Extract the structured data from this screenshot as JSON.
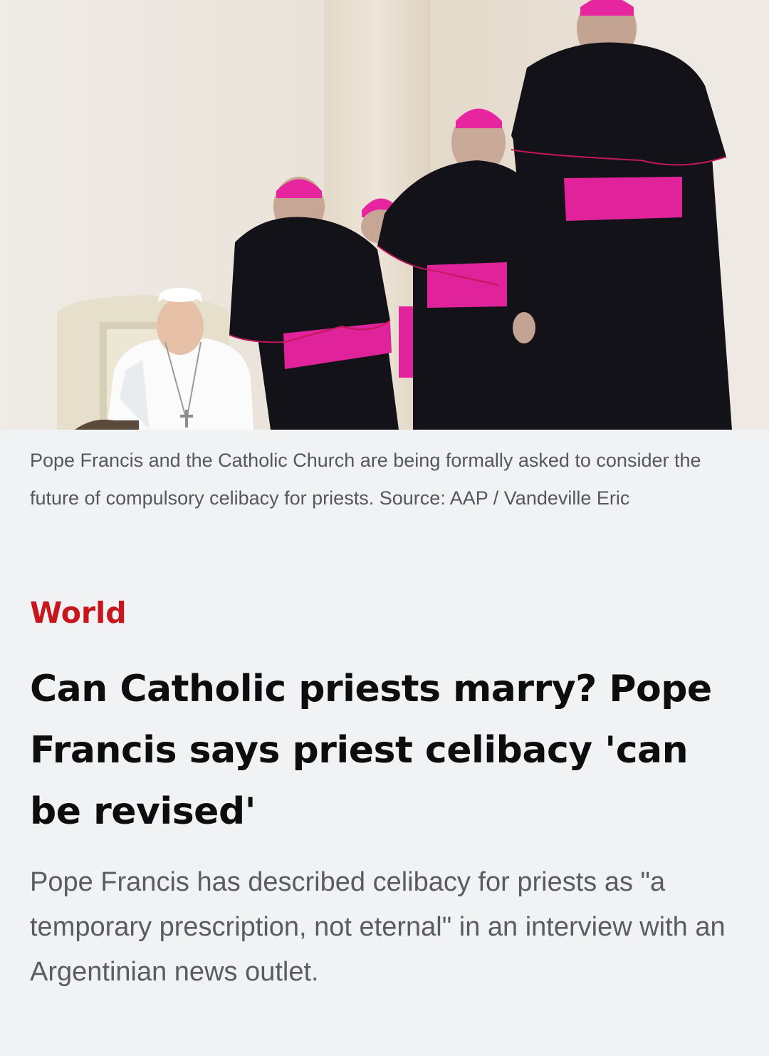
{
  "article": {
    "image": {
      "alt_subject": "pope-with-bishops-photo"
    },
    "caption": "Pope Francis and the Catholic Church are being formally asked to consider the future of compulsory celibacy for priests. Source: AAP / Vandeville Eric",
    "category": "World",
    "headline": "Can Catholic priests marry? Pope Francis says priest celibacy 'can be revised'",
    "summary": "Pope Francis has described celibacy for priests as \"a temporary prescription, not eternal\" in an interview with an Argentinian news outlet."
  },
  "colors": {
    "category": "#c8161d",
    "background": "#f1f2f4",
    "headline": "#0d0d0e",
    "body_text": "#5a5c61",
    "sash": "#e0239a",
    "cassock": "#141219"
  }
}
